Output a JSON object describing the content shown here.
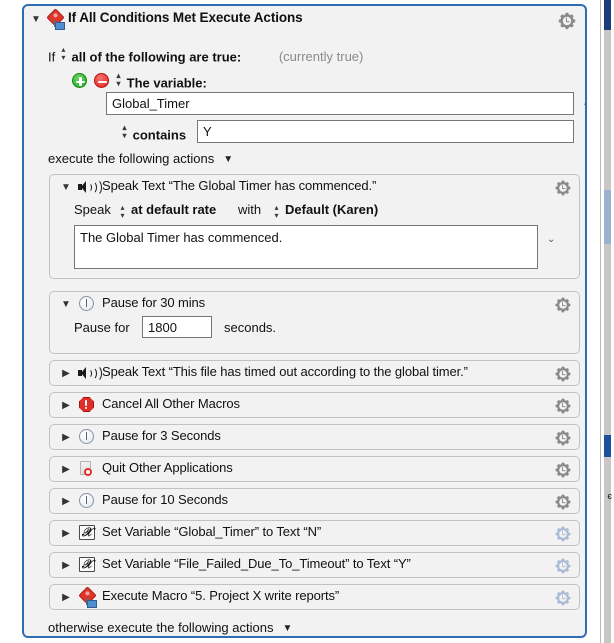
{
  "if_action": {
    "title": "If All Conditions Met Execute Actions",
    "icon": "macro-kite-icon",
    "disclosure": "▼",
    "gear": "gear-icon",
    "condition_header": {
      "if_word": "If",
      "stepper_up": "▴",
      "stepper_down": "▾",
      "mode_label": "all of the following are true:",
      "state_label": "(currently true)"
    },
    "condition": {
      "add_button": "+",
      "remove_button": "−",
      "type_label": "The variable:",
      "variable_value": "Global_Timer",
      "variable_placeholder": "Variable",
      "combo_chevron": "⌄",
      "operator_label": "contains",
      "operand_value": "Y",
      "operand_placeholder": "Text"
    },
    "execute_label": "execute the following actions",
    "execute_triangle": "▼",
    "otherwise_label": "otherwise execute the following actions",
    "otherwise_triangle": "▼"
  },
  "actions": [
    {
      "id": "speak-text-1",
      "icon": "speaker-icon",
      "disclosure": "▼",
      "expanded": true,
      "title": "Speak Text “The Global Timer has commenced.”",
      "gear": "gear-icon",
      "rate_prefix": "Speak",
      "rate_value": "at default rate",
      "voice_prefix": "with",
      "voice_value": "Default (Karen)",
      "text_value": "The Global Timer has commenced.",
      "text_placeholder": "Text to speak",
      "combo_chevron": "⌄"
    },
    {
      "id": "pause-1",
      "icon": "clock-icon",
      "disclosure": "▼",
      "expanded": true,
      "title": "Pause for 30 mins",
      "gear": "gear-icon",
      "pause_prefix": "Pause for",
      "pause_value": "1800",
      "pause_suffix": "seconds."
    },
    {
      "id": "speak-text-2",
      "icon": "speaker-icon",
      "disclosure": "▶",
      "expanded": false,
      "title": "Speak Text “This file has timed out according to the global timer.”",
      "gear": "gear-icon"
    },
    {
      "id": "cancel-all-other-macros",
      "icon": "cancel-icon",
      "disclosure": "▶",
      "expanded": false,
      "title": "Cancel All Other Macros",
      "gear": "gear-icon"
    },
    {
      "id": "pause-2",
      "icon": "clock-icon",
      "disclosure": "▶",
      "expanded": false,
      "title": "Pause for 3 Seconds",
      "gear": "gear-icon"
    },
    {
      "id": "quit-other-applications",
      "icon": "quit-application-icon",
      "disclosure": "▶",
      "expanded": false,
      "title": "Quit Other Applications",
      "gear": "gear-icon"
    },
    {
      "id": "pause-3",
      "icon": "clock-icon",
      "disclosure": "▶",
      "expanded": false,
      "title": "Pause for 10 Seconds",
      "gear": "gear-icon"
    },
    {
      "id": "set-variable-1",
      "icon": "set-variable-icon",
      "disclosure": "▶",
      "expanded": false,
      "title": "Set Variable “Global_Timer” to Text “N”",
      "gear": "gear-icon"
    },
    {
      "id": "set-variable-2",
      "icon": "set-variable-icon",
      "disclosure": "▶",
      "expanded": false,
      "title": "Set Variable “File_Failed_Due_To_Timeout” to Text “Y”",
      "gear": "gear-icon"
    },
    {
      "id": "execute-macro-1",
      "icon": "macro-kite-icon",
      "disclosure": "▶",
      "expanded": false,
      "title": "Execute Macro “5. Project X write reports”",
      "gear": "gear-icon"
    }
  ],
  "set_variable_glyph": "𝒳",
  "colors": {
    "window_border": "#2f6cb5",
    "action_background": "#f2f2f2",
    "action_border": "#c2c2c2",
    "add_button": "#18a818",
    "remove_button": "#e0211b",
    "cancel_icon": "#df2d27",
    "muted_text": "#8a8a8a"
  },
  "background_window": {
    "scrollbar_track": "#c9c6c3",
    "accent_top": "#1c3f7c",
    "accent_mid": "#9cb0d0",
    "accent_low": "#1c4f9c",
    "glyph": "є"
  }
}
